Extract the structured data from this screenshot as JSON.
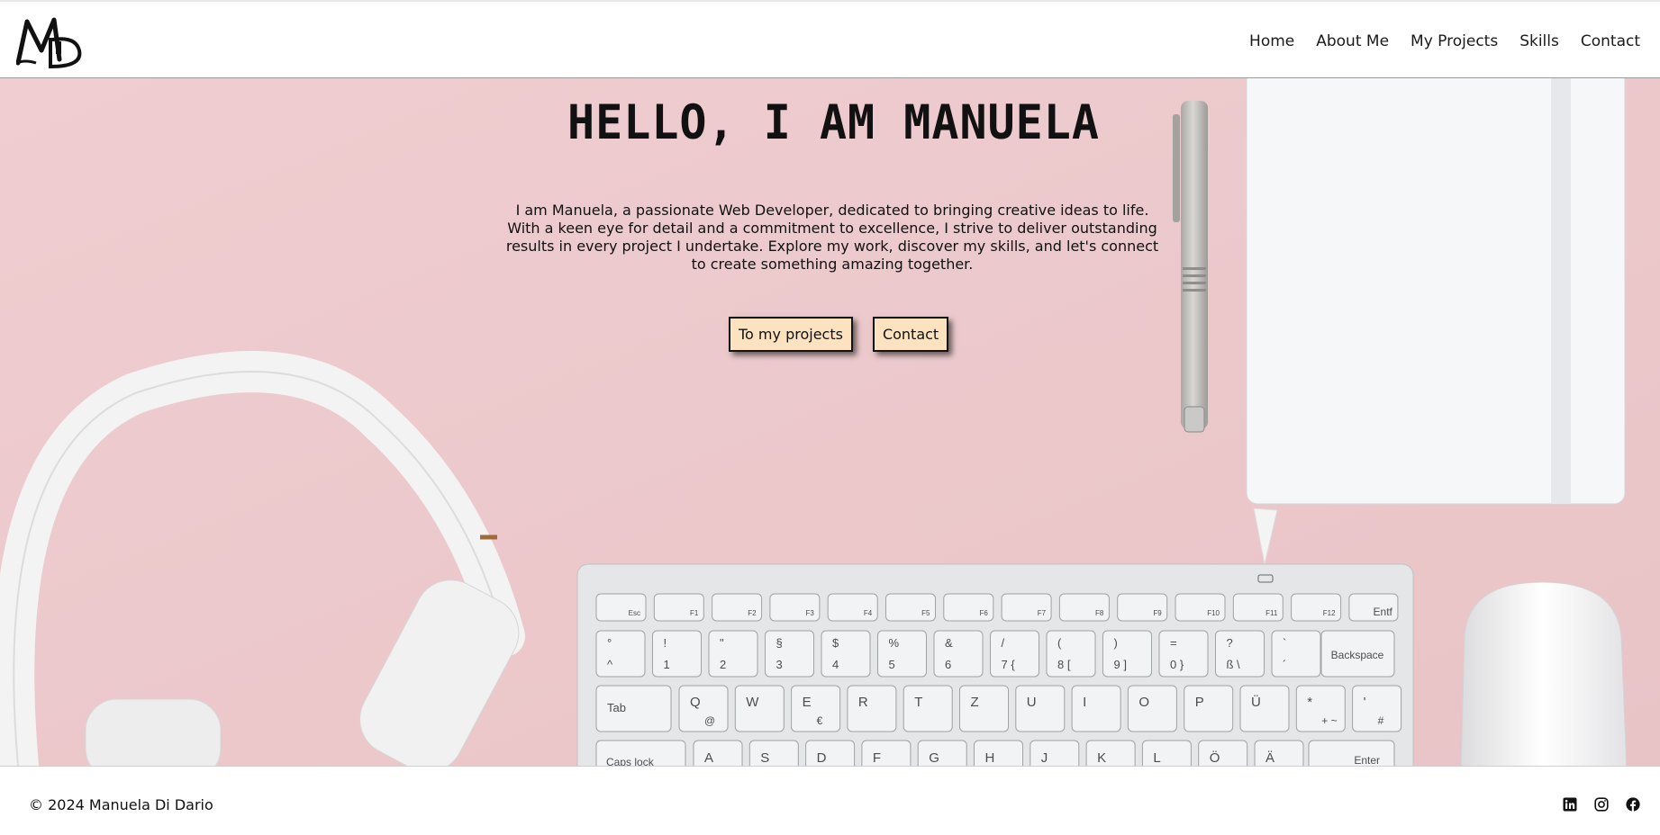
{
  "header": {
    "logo_text": "MD",
    "nav": [
      "Home",
      "About Me",
      "My Projects",
      "Skills",
      "Contact"
    ]
  },
  "hero": {
    "title": "HELLO, I AM MANUELA",
    "intro": "I am Manuela, a passionate Web Developer, dedicated to bringing creative ideas to life. With a keen eye for detail and a commitment to excellence, I strive to deliver outstanding results in every project I undertake. Explore my work, discover my skills, and let's connect to create something amazing together.",
    "buttons": {
      "projects": "To my projects",
      "contact": "Contact"
    },
    "keyboard": {
      "function_row": [
        "Esc",
        "F1",
        "F2",
        "F3",
        "F4",
        "F5",
        "F6",
        "F7",
        "F8",
        "F9",
        "F10",
        "F11",
        "F12",
        "Entf"
      ],
      "number_row": [
        [
          "°",
          "^"
        ],
        [
          "!",
          "1"
        ],
        [
          "\"",
          "2"
        ],
        [
          "§",
          "3"
        ],
        [
          "$",
          "4"
        ],
        [
          "%",
          "5"
        ],
        [
          "&",
          "6"
        ],
        [
          "/",
          "7 {"
        ],
        [
          "(",
          "8 ["
        ],
        [
          ")",
          "9 ]"
        ],
        [
          "=",
          "0 }"
        ],
        [
          "?",
          "ß \\"
        ],
        [
          "`",
          "´"
        ]
      ],
      "backspace": "Backspace",
      "tab": "Tab",
      "qwertz_row": [
        [
          "Q",
          "@"
        ],
        [
          "W",
          ""
        ],
        [
          "E",
          "€"
        ],
        [
          "R",
          ""
        ],
        [
          "T",
          ""
        ],
        [
          "Z",
          ""
        ],
        [
          "U",
          ""
        ],
        [
          "I",
          ""
        ],
        [
          "O",
          ""
        ],
        [
          "P",
          ""
        ],
        [
          "Ü",
          ""
        ],
        [
          "*",
          "+ ~"
        ],
        [
          "'",
          "#"
        ]
      ],
      "caps": "Caps lock",
      "home_row": [
        "A",
        "S",
        "D",
        "F",
        "G",
        "H",
        "J",
        "K",
        "L",
        "Ö",
        "Ä"
      ],
      "enter": "Enter"
    }
  },
  "footer": {
    "copyright": "© 2024 Manuela Di Dario",
    "socials": [
      "linkedin-icon",
      "instagram-icon",
      "facebook-icon"
    ]
  },
  "colors": {
    "background_pink": "#ecc9cc",
    "button_fill": "#fde2bf",
    "text": "#111111"
  }
}
